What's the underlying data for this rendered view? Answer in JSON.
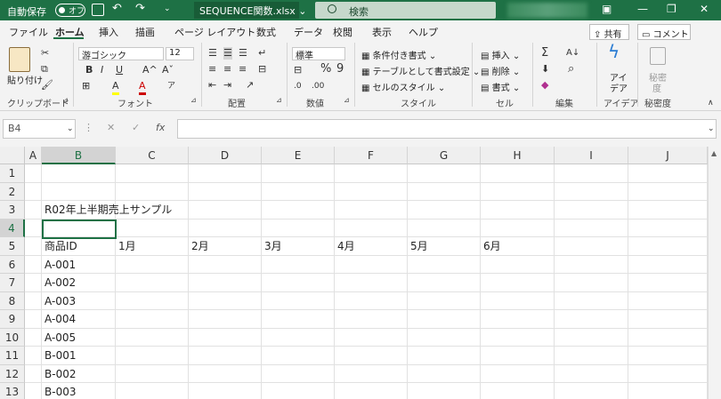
{
  "titlebar": {
    "autosave_label": "自動保存",
    "autosave_state": "オフ",
    "filename": "SEQUENCE関数.xlsx",
    "filename_dropdown": "⌄",
    "search_placeholder": "検索",
    "undo_symbol": "↶",
    "redo_symbol": "↷",
    "minimize": "—",
    "restore": "❐",
    "close": "✕",
    "ribbon_display": "▣"
  },
  "tabs": [
    "ファイル",
    "ホーム",
    "挿入",
    "描画",
    "ページ レイアウト",
    "数式",
    "データ",
    "校閲",
    "表示",
    "ヘルプ"
  ],
  "active_tab": "ホーム",
  "share_label": "共有",
  "comment_label": "コメント",
  "ribbon": {
    "clipboard": {
      "paste": "貼り付け",
      "group": "クリップボード"
    },
    "font": {
      "name": "游ゴシック",
      "size": "12",
      "bold": "B",
      "italic": "I",
      "underline": "U",
      "grow": "A^",
      "shrink": "Aˇ",
      "fill": "A",
      "color": "A",
      "group": "フォント"
    },
    "alignment": {
      "group": "配置"
    },
    "number": {
      "format": "標準",
      "percent": "%",
      "comma": "9",
      "group": "数値"
    },
    "styles": {
      "conditional": "条件付き書式",
      "table": "テーブルとして書式設定",
      "cell": "セルのスタイル",
      "group": "スタイル"
    },
    "cells": {
      "insert": "挿入",
      "delete": "削除",
      "format": "書式",
      "group": "セル"
    },
    "editing": {
      "sum": "Σ",
      "sort": "A↓",
      "find": "⌕",
      "clear": "◆",
      "group": "編集"
    },
    "ideas": {
      "label1": "アイ",
      "label2": "デア",
      "group": "アイデア"
    },
    "sensitivity": {
      "label1": "秘密",
      "label2": "度",
      "group": "秘密度"
    }
  },
  "formula_bar": {
    "name_box": "B4",
    "cancel": "✕",
    "enter": "✓",
    "fx": "fx",
    "formula": ""
  },
  "grid": {
    "columns": [
      "A",
      "B",
      "C",
      "D",
      "E",
      "F",
      "G",
      "H",
      "I",
      "J"
    ],
    "rows": [
      "1",
      "2",
      "3",
      "4",
      "5",
      "6",
      "7",
      "8",
      "9",
      "10",
      "11",
      "12",
      "13"
    ],
    "selected_cell": "B4",
    "cells": {
      "B3": "R02年上半期売上サンプル",
      "B5": "商品ID",
      "C5": "1月",
      "D5": "2月",
      "E5": "3月",
      "F5": "4月",
      "G5": "5月",
      "H5": "6月",
      "B6": "A-001",
      "B7": "A-002",
      "B8": "A-003",
      "B9": "A-004",
      "B10": "A-005",
      "B11": "B-001",
      "B12": "B-002",
      "B13": "B-003"
    }
  },
  "colors": {
    "accent": "#1e7145",
    "titlebar": "#1e7145"
  }
}
